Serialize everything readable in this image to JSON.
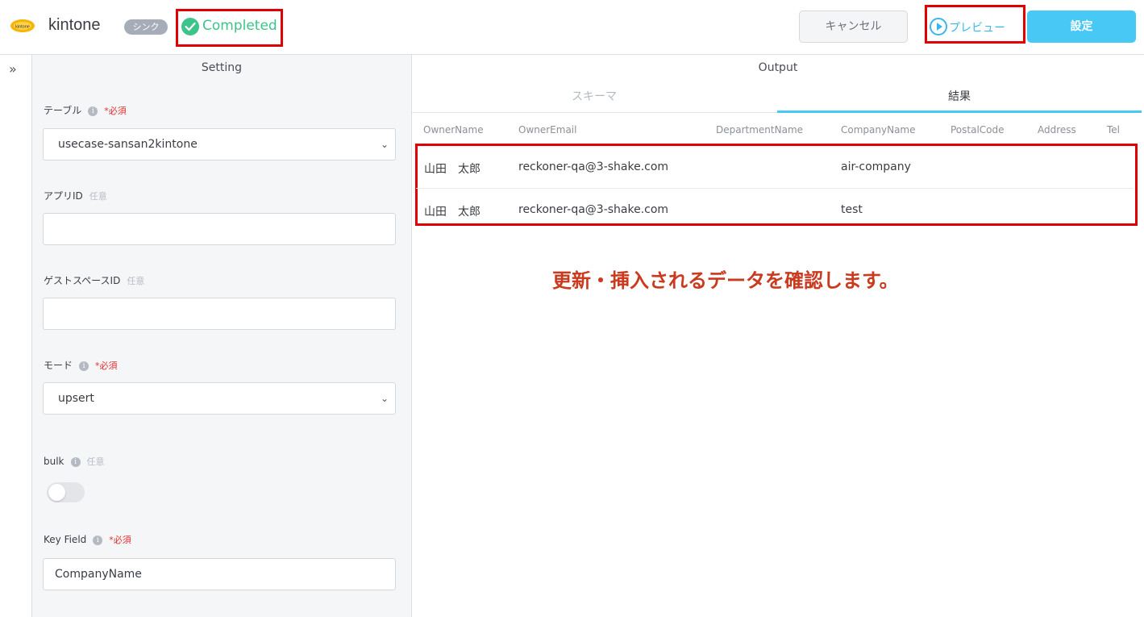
{
  "header": {
    "app_name": "kintone",
    "logo_text": "kintone",
    "tag": "シンク",
    "status": "Completed",
    "cancel_label": "キャンセル",
    "preview_label": "プレビュー",
    "setting_label": "設定"
  },
  "setting": {
    "title": "Setting",
    "fields": {
      "table": {
        "label": "テーブル",
        "required": "*必須",
        "value": "usecase-sansan2kintone"
      },
      "app_id": {
        "label": "アプリID",
        "optional": "任意",
        "value": ""
      },
      "guest_space_id": {
        "label": "ゲストスペースID",
        "optional": "任意",
        "value": ""
      },
      "mode": {
        "label": "モード",
        "required": "*必須",
        "value": "upsert"
      },
      "bulk": {
        "label": "bulk",
        "optional": "任意",
        "enabled": false
      },
      "key_field": {
        "label": "Key Field",
        "required": "*必須",
        "value": "CompanyName"
      }
    }
  },
  "output": {
    "title": "Output",
    "tabs": {
      "schema": "スキーマ",
      "result": "結果"
    },
    "columns": [
      "OwnerName",
      "OwnerEmail",
      "DepartmentName",
      "CompanyName",
      "PostalCode",
      "Address",
      "Tel"
    ],
    "rows": [
      {
        "owner_name": "山田　太郎",
        "owner_email": "reckoner-qa@3-shake.com",
        "company_name": "air-company"
      },
      {
        "owner_name": "山田　太郎",
        "owner_email": "reckoner-qa@3-shake.com",
        "company_name": "test"
      }
    ],
    "annotation": "更新・挿入されるデータを確認します。"
  },
  "colors": {
    "accent": "#47c8f5",
    "status_green": "#3cc48a",
    "highlight_red": "#e00000",
    "annotation_red": "#c93a1f"
  }
}
